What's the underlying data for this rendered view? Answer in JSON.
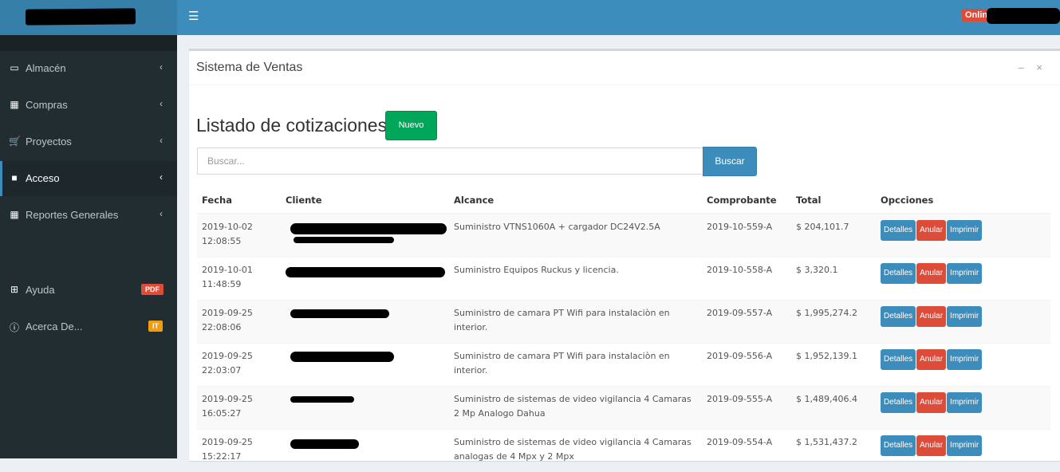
{
  "topbar": {
    "menu_icon": "bars-icon",
    "online_label": "Online"
  },
  "sidebar": {
    "items": [
      {
        "label": "Almacén",
        "icon": "laptop-icon",
        "chevron": "‹"
      },
      {
        "label": "Compras",
        "icon": "grid-icon",
        "chevron": "‹"
      },
      {
        "label": "Proyectos",
        "icon": "cart-icon",
        "chevron": "‹"
      },
      {
        "label": "Acceso",
        "icon": "folder-icon",
        "chevron": "‹"
      },
      {
        "label": "Reportes Generales",
        "icon": "grid-icon",
        "chevron": "‹"
      },
      {
        "label": "Ayuda",
        "icon": "plus-square-icon",
        "badge": "PDF"
      },
      {
        "label": "Acerca De...",
        "icon": "info-circle-icon",
        "badge": "IT"
      }
    ]
  },
  "box": {
    "title": "Sistema de Ventas",
    "minimize": "–",
    "close": "×"
  },
  "page": {
    "heading": "Listado de cotizaciones",
    "new_button": "Nuevo"
  },
  "search": {
    "placeholder": "Buscar...",
    "button": "Buscar"
  },
  "table": {
    "headers": [
      "Fecha",
      "Cliente",
      "Alcance",
      "Comprobante",
      "Total",
      "Opcciones"
    ],
    "action_labels": {
      "details": "Detalles",
      "cancel": "Anular",
      "print": "Imprimir"
    },
    "rows": [
      {
        "date": "2019-10-02",
        "time": "12:08:55",
        "alcance": "Suministro VTNS1060A + cargador DC24V2.5A",
        "comprobante": "2019-10-559-A",
        "total": "$ 204,101.7"
      },
      {
        "date": "2019-10-01",
        "time": "11:48:59",
        "alcance": "Suministro Equipos Ruckus y licencia.",
        "comprobante": "2019-10-558-A",
        "total": "$ 3,320.1"
      },
      {
        "date": "2019-09-25",
        "time": "22:08:06",
        "alcance": "Suministro de camara PT Wifi para instalaciòn en interior.",
        "comprobante": "2019-09-557-A",
        "total": "$ 1,995,274.2"
      },
      {
        "date": "2019-09-25",
        "time": "22:03:07",
        "alcance": "Suministro de camara PT Wifi para instalaciòn en interior.",
        "comprobante": "2019-09-556-A",
        "total": "$ 1,952,139.1"
      },
      {
        "date": "2019-09-25",
        "time": "16:05:27",
        "alcance": "Suministro de sistemas de video vigilancia 4 Camaras 2 Mp Analogo Dahua",
        "comprobante": "2019-09-555-A",
        "total": "$ 1,489,406.4"
      },
      {
        "date": "2019-09-25",
        "time": "15:22:17",
        "alcance": "Suministro de sistemas de video vigilancia 4 Camaras analogas de 4 Mpx y 2 Mpx",
        "comprobante": "2019-09-554-A",
        "total": "$ 1,531,437.2"
      }
    ]
  },
  "colors": {
    "primary": "#3c8dbc",
    "success": "#00a65a",
    "danger": "#dd4b39",
    "sidebar": "#222d32"
  }
}
